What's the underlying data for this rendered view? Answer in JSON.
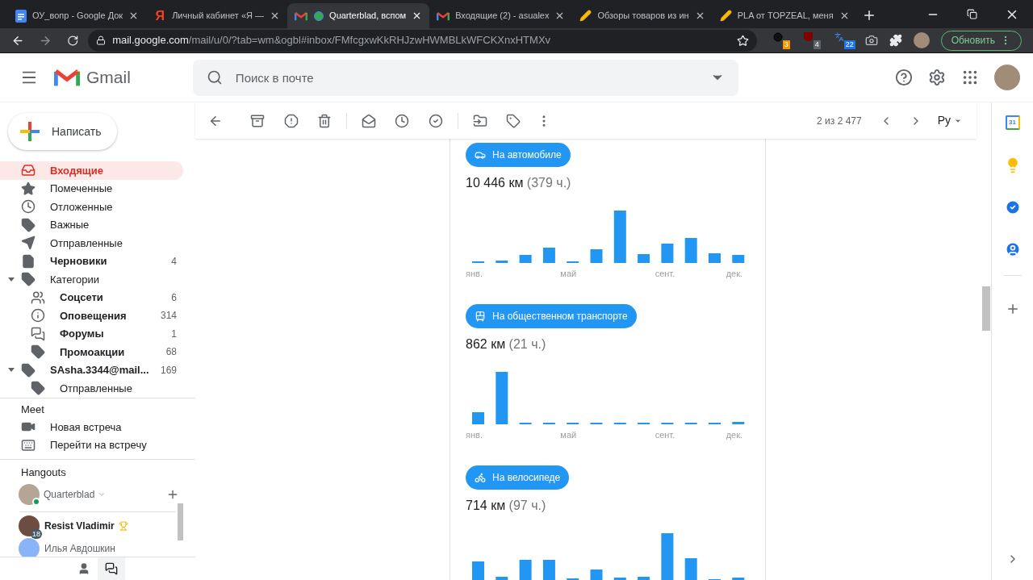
{
  "browser": {
    "tabs": [
      {
        "title": "ОУ_вопр - Google Док",
        "kind": "docs",
        "selected": false
      },
      {
        "title": "Личный кабинет «Я —",
        "kind": "yandex",
        "icon_text": "Я",
        "selected": false
      },
      {
        "title": "Quarterblad, вспом",
        "kind": "hangouts",
        "selected": true
      },
      {
        "title": "Входящие (2) - asualex",
        "kind": "gmail",
        "selected": false
      },
      {
        "title": "Обзоры товаров из ин",
        "kind": "pencil",
        "selected": false
      },
      {
        "title": "PLA от TOPZEAL, меня",
        "kind": "pencil",
        "selected": false
      }
    ],
    "address": {
      "domain": "mail.google.com",
      "path": "/mail/u/0/?tab=wm&ogbl#inbox/FMfcgxwKkRHJzwHWMBLkWFCKXnxHTMXv"
    },
    "extension_badges": [
      "3",
      "4",
      "22"
    ],
    "update_button": "Обновить"
  },
  "gmail": {
    "logo_text": "Gmail",
    "search": {
      "placeholder": "Поиск в почте"
    },
    "compose": "Написать",
    "nav": [
      {
        "label": "Входящие",
        "selected": true,
        "unread": true
      },
      {
        "label": "Помеченные",
        "selected": false,
        "unread": false
      },
      {
        "label": "Отложенные",
        "selected": false,
        "unread": false
      },
      {
        "label": "Важные",
        "selected": false,
        "unread": false
      },
      {
        "label": "Отправленные",
        "selected": false,
        "unread": false
      },
      {
        "label": "Черновики",
        "count": "4",
        "selected": false,
        "unread": true
      },
      {
        "label": "Категории",
        "selected": false,
        "unread": false,
        "expanded": true,
        "children": [
          {
            "label": "Соцсети",
            "count": "6",
            "selected": false,
            "unread": true
          },
          {
            "label": "Оповещения",
            "count": "314",
            "selected": false,
            "unread": true
          },
          {
            "label": "Форумы",
            "count": "1",
            "selected": false,
            "unread": true
          },
          {
            "label": "Промоакции",
            "count": "68",
            "selected": false,
            "unread": true
          }
        ]
      },
      {
        "label": "SAsha.3344@mail...",
        "count": "169",
        "selected": false,
        "unread": true,
        "expanded": true,
        "children": [
          {
            "label": "Отправленные",
            "selected": false,
            "unread": false
          }
        ]
      }
    ],
    "meet": {
      "title": "Meet",
      "items": [
        "Новая встреча",
        "Перейти на встречу"
      ]
    },
    "hangouts": {
      "title": "Hangouts",
      "user": {
        "name": "Quarterblad",
        "online": true
      },
      "contacts": [
        {
          "name": "Resist Vladimir",
          "badge": "18",
          "unread": true
        },
        {
          "name": "Илья Авдошкин",
          "unread": false
        }
      ]
    },
    "toolbar": {
      "pager": "2 из 2 477",
      "language": "Ру"
    },
    "sections": [
      {
        "kind": "car",
        "label": "На автомобиле",
        "distance": "10 446 км",
        "duration": "(379 ч.)",
        "months": [
          "янв.",
          "май",
          "сент.",
          "дек."
        ]
      },
      {
        "kind": "transit",
        "label": "На общественном транспорте",
        "distance": "862 км",
        "duration": "(21 ч.)",
        "months": [
          "янв.",
          "май",
          "сент.",
          "дек."
        ]
      },
      {
        "kind": "bike",
        "label": "На велосипеде",
        "distance": "714 км",
        "duration": "(97 ч.)"
      }
    ],
    "side_panel": {
      "calendar_day": "31"
    }
  }
}
